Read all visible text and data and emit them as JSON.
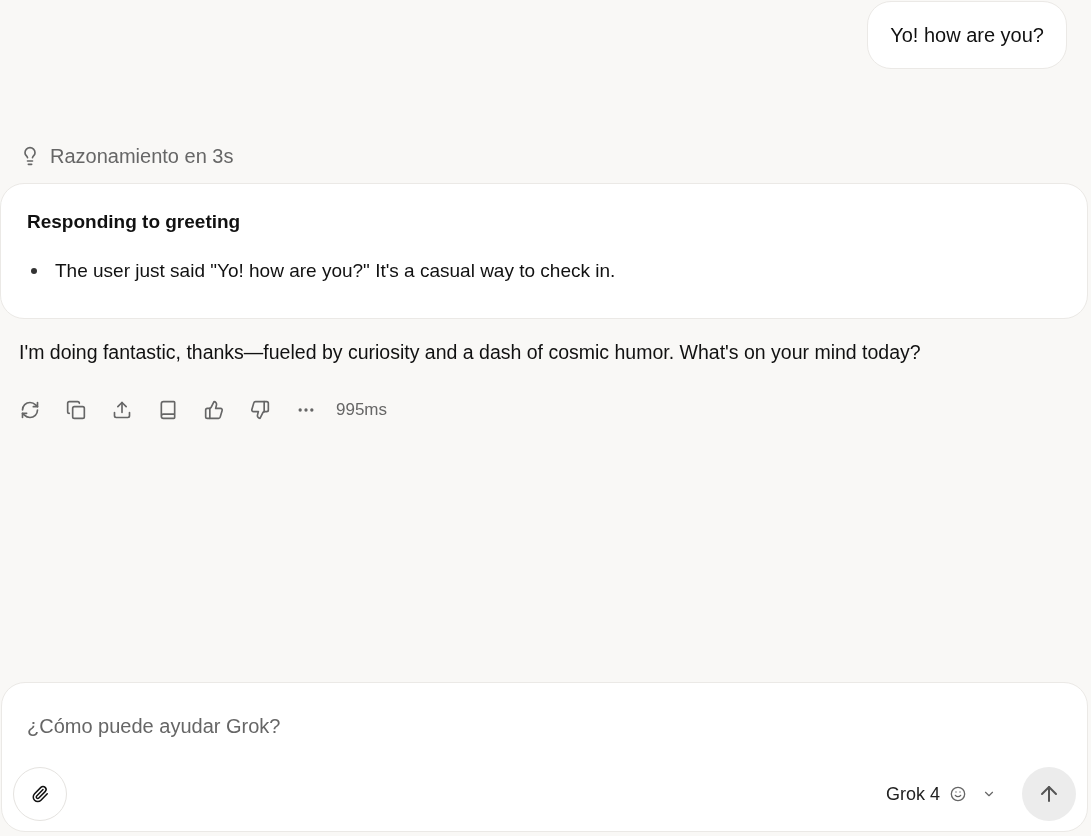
{
  "user_message": "Yo! how are you?",
  "reasoning": {
    "label": "Razonamiento en 3s",
    "title": "Responding to greeting",
    "bullets": [
      "The user just said \"Yo! how are you?\" It's a casual way to check in."
    ]
  },
  "response": "I'm doing fantastic, thanks—fueled by curiosity and a dash of cosmic humor. What's on your mind today?",
  "response_time": "995ms",
  "composer": {
    "placeholder": "¿Cómo puede ayudar Grok?",
    "model": "Grok 4"
  }
}
